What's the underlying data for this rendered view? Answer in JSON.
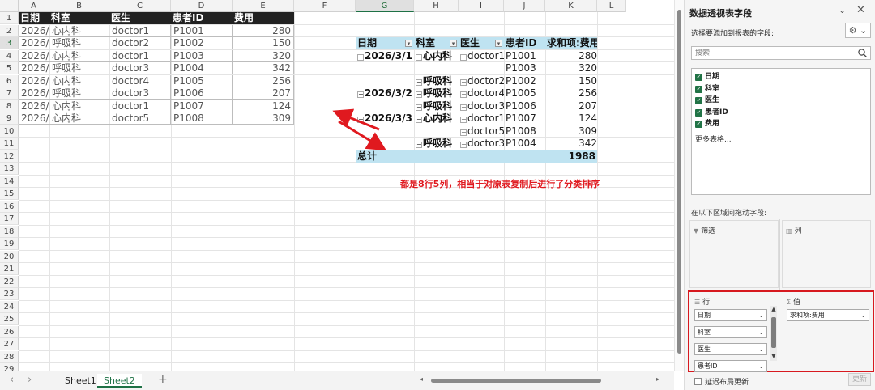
{
  "sheet": {
    "columns": [
      "A",
      "B",
      "C",
      "D",
      "E",
      "F",
      "G",
      "H",
      "I",
      "J",
      "K",
      "L"
    ],
    "rows": [
      "1",
      "2",
      "3",
      "4",
      "5",
      "6",
      "7",
      "8",
      "9",
      "10",
      "11",
      "12",
      "13",
      "14",
      "15",
      "16",
      "17",
      "18",
      "19",
      "20",
      "21",
      "22",
      "23",
      "24",
      "25",
      "26",
      "27",
      "28",
      "29",
      "30"
    ],
    "source_headers": [
      "日期",
      "科室",
      "医生",
      "患者ID",
      "费用"
    ],
    "source_rows": [
      [
        "2026/3/1",
        "心内科",
        "doctor1",
        "P1001",
        "280"
      ],
      [
        "2026/3/1",
        "呼吸科",
        "doctor2",
        "P1002",
        "150"
      ],
      [
        "2026/3/1",
        "心内科",
        "doctor1",
        "P1003",
        "320"
      ],
      [
        "2026/3/3",
        "呼吸科",
        "doctor3",
        "P1004",
        "342"
      ],
      [
        "2026/3/2",
        "心内科",
        "doctor4",
        "P1005",
        "256"
      ],
      [
        "2026/3/2",
        "呼吸科",
        "doctor3",
        "P1006",
        "207"
      ],
      [
        "2026/3/3",
        "心内科",
        "doctor1",
        "P1007",
        "124"
      ],
      [
        "2026/3/3",
        "心内科",
        "doctor5",
        "P1008",
        "309"
      ]
    ],
    "pivot_headers": [
      "日期",
      "科室",
      "医生",
      "患者ID",
      "求和项:费用"
    ],
    "pivot_rows": [
      [
        "2026/3/1",
        "心内科",
        "doctor1",
        "P1001",
        "280"
      ],
      [
        "",
        "",
        "",
        "P1003",
        "320"
      ],
      [
        "",
        "呼吸科",
        "doctor2",
        "P1002",
        "150"
      ],
      [
        "2026/3/2",
        "呼吸科",
        "doctor4",
        "P1005",
        "256"
      ],
      [
        "",
        "呼吸科",
        "doctor3",
        "P1006",
        "207"
      ],
      [
        "2026/3/3",
        "心内科",
        "doctor1",
        "P1007",
        "124"
      ],
      [
        "",
        "",
        "doctor5",
        "P1008",
        "309"
      ],
      [
        "",
        "呼吸科",
        "doctor3",
        "P1004",
        "342"
      ]
    ],
    "pivot_total_label": "总计",
    "pivot_total_value": "1988",
    "annotation": "都是8行5列，相当于对原表复制后进行了分类排序"
  },
  "tabs": {
    "sheets": [
      "Sheet1",
      "Sheet2"
    ],
    "active": "Sheet2",
    "add": "+"
  },
  "pane": {
    "title": "数据透视表字段",
    "choose_label": "选择要添加到报表的字段:",
    "search_placeholder": "搜索",
    "fields": [
      "日期",
      "科室",
      "医生",
      "患者ID",
      "费用"
    ],
    "more_tables": "更多表格...",
    "drag_label": "在以下区域间拖动字段:",
    "filter_label": "筛选",
    "columns_label": "列",
    "rows_label": "行",
    "values_label": "值",
    "row_fields": [
      "日期",
      "科室",
      "医生",
      "患者ID"
    ],
    "value_fields": [
      "求和项:费用"
    ],
    "defer_label": "延迟布局更新",
    "update_label": "更新"
  },
  "colors": {
    "accent": "#1e7145",
    "pivot_header": "#bfe3f1",
    "annotation": "#e0191f"
  }
}
